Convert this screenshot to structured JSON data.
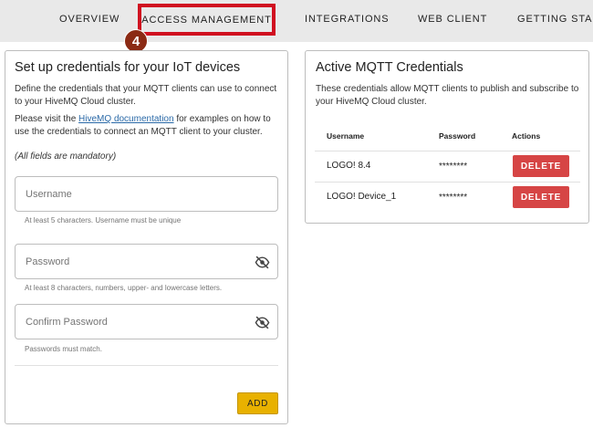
{
  "nav": {
    "tabs": [
      {
        "label": "OVERVIEW"
      },
      {
        "label": "ACCESS MANAGEMENT"
      },
      {
        "label": "INTEGRATIONS"
      },
      {
        "label": "WEB CLIENT"
      },
      {
        "label": "GETTING START"
      }
    ],
    "active_tab": "ACCESS MANAGEMENT",
    "step_badge": "4",
    "highlight_color": "#d01020"
  },
  "setup": {
    "title": "Set up credentials for your IoT devices",
    "intro": "Define the credentials that your MQTT clients can use to connect to your HiveMQ Cloud cluster.",
    "visit_prefix": "Please visit the ",
    "visit_link": "HiveMQ documentation",
    "visit_suffix": " for examples on how to use the credentials to connect an MQTT client to your cluster.",
    "mandatory_note": "(All fields are mandatory)",
    "username": {
      "placeholder": "Username",
      "value": "",
      "hint": "At least 5 characters. Username must be unique"
    },
    "password": {
      "placeholder": "Password",
      "value": "",
      "hint": "At least 8 characters, numbers, upper- and lowercase letters."
    },
    "confirm_password": {
      "placeholder": "Confirm Password",
      "value": "",
      "hint": "Passwords must match."
    },
    "add_label": "ADD"
  },
  "credentials": {
    "title": "Active MQTT Credentials",
    "description": "These credentials allow MQTT clients to publish and subscribe to your HiveMQ Cloud cluster.",
    "columns": [
      "Username",
      "Password",
      "Actions"
    ],
    "rows": [
      {
        "username": "LOGO! 8.4",
        "password": "********",
        "action": "DELETE"
      },
      {
        "username": "LOGO! Device_1",
        "password": "********",
        "action": "DELETE"
      }
    ]
  },
  "colors": {
    "add_button": "#e8b100",
    "delete_button": "#d64545",
    "link": "#2b6aa8"
  },
  "icons": {
    "password_toggle": "eye-off-icon"
  }
}
